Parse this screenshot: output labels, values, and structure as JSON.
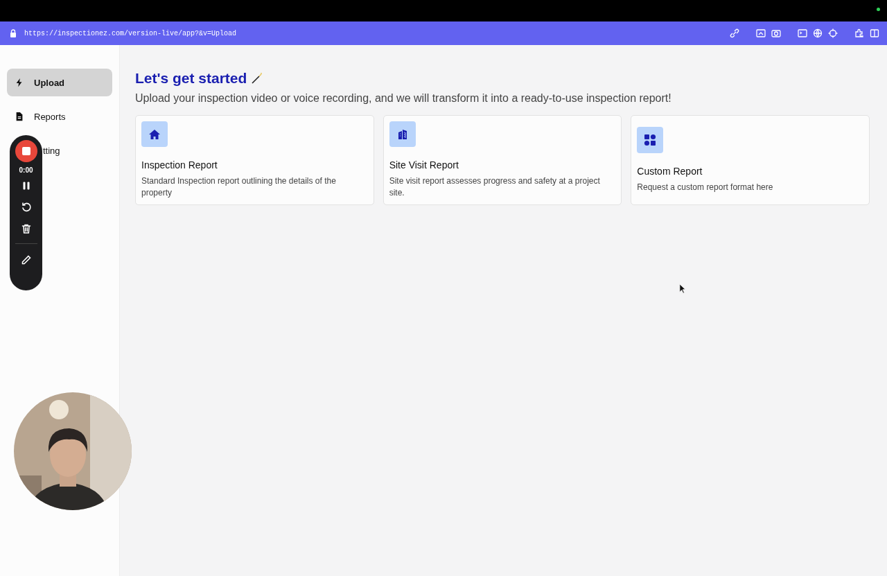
{
  "browser": {
    "url": "https://inspectionez.com/version-live/app?&v=Upload"
  },
  "sidebar": {
    "items": [
      {
        "label": "Upload",
        "selected": true
      },
      {
        "label": "Reports",
        "selected": false
      },
      {
        "label": "tting",
        "selected": false
      }
    ]
  },
  "recorder": {
    "time": "0:00"
  },
  "main": {
    "title": "Let's get started",
    "subtitle": "Upload your inspection video or voice recording, and we will transform it into a ready-to-use inspection report!",
    "cards": [
      {
        "title": "Inspection Report",
        "description": "Standard Inspection report outlining the details of the property"
      },
      {
        "title": "Site Visit Report",
        "description": "Site visit report assesses progress and safety at a project site."
      },
      {
        "title": "Custom Report",
        "description": "Request a custom report format here"
      }
    ]
  }
}
